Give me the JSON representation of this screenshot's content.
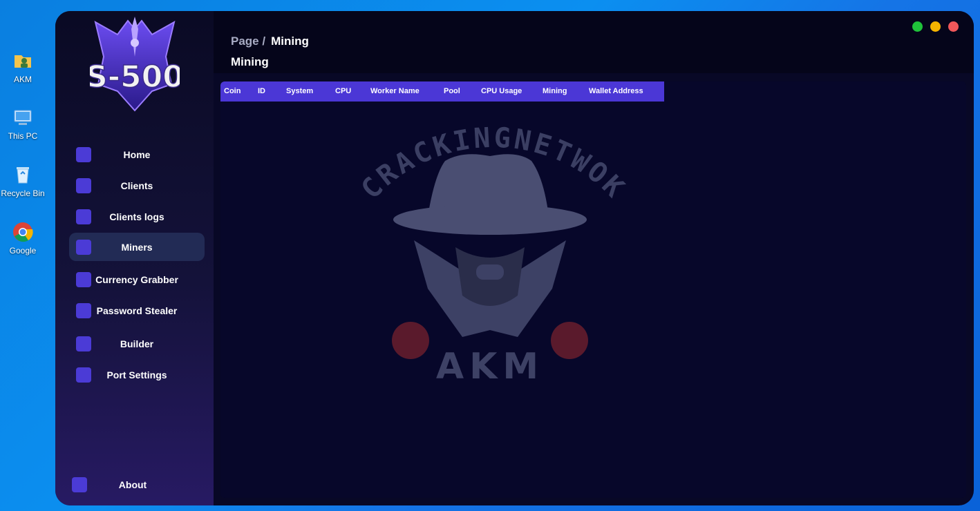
{
  "desktop": {
    "icons": [
      {
        "label": "AKM",
        "icon": "user-folder-icon"
      },
      {
        "label": "This PC",
        "icon": "computer-icon"
      },
      {
        "label": "Recycle Bin",
        "icon": "recycle-bin-icon"
      },
      {
        "label": "Google",
        "icon": "chrome-icon"
      }
    ]
  },
  "app": {
    "logo_text": "S-500",
    "window_controls": {
      "colors": [
        "#1fc23a",
        "#f5b400",
        "#f0575a"
      ]
    }
  },
  "sidebar": {
    "items": [
      {
        "label": "Home",
        "icon": "home-icon",
        "active": false
      },
      {
        "label": "Clients",
        "icon": "users-icon",
        "active": false
      },
      {
        "label": "Clients logs",
        "icon": "user-log-icon",
        "active": false
      },
      {
        "label": "Miners",
        "icon": "pickaxe-icon",
        "active": true
      },
      {
        "label": "Currency Grabber",
        "icon": "wallet-icon",
        "active": false
      },
      {
        "label": "Password Stealer",
        "icon": "key-icon",
        "active": false
      },
      {
        "label": "Builder",
        "icon": "builder-icon",
        "active": false
      },
      {
        "label": "Port Settings",
        "icon": "port-icon",
        "active": false
      }
    ],
    "about": {
      "label": "About",
      "icon": "user-icon"
    }
  },
  "header": {
    "breadcrumb_page": "Page /",
    "breadcrumb_current": "Mining",
    "title": "Mining"
  },
  "table": {
    "columns": [
      "Coin",
      "ID",
      "System",
      "CPU",
      "Worker Name",
      "Pool",
      "CPU Usage",
      "Mining",
      "Wallet Address"
    ],
    "rows": []
  },
  "watermark": {
    "arc_text": "CRACKINGNETWOK",
    "bottom_text": "AKM"
  },
  "colors": {
    "accent": "#4b37d6",
    "active_nav": "#222b55",
    "panel": "#07072a"
  }
}
